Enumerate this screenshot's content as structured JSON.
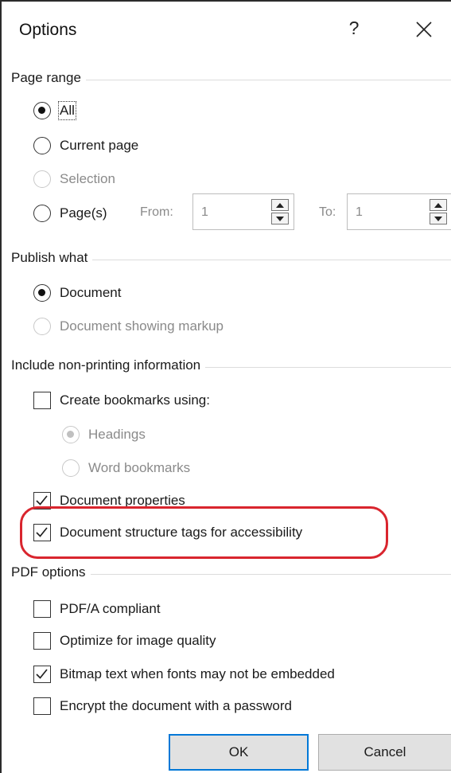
{
  "dialog": {
    "title": "Options",
    "help_label": "?"
  },
  "page_range": {
    "title": "Page range",
    "all": "All",
    "current_page": "Current page",
    "selection": "Selection",
    "pages": "Page(s)",
    "from_label": "From:",
    "from_value": "1",
    "to_label": "To:",
    "to_value": "1"
  },
  "publish_what": {
    "title": "Publish what",
    "document": "Document",
    "document_markup": "Document showing markup"
  },
  "non_printing": {
    "title": "Include non-printing information",
    "create_bookmarks": "Create bookmarks using:",
    "headings": "Headings",
    "word_bookmarks": "Word bookmarks",
    "doc_properties": "Document properties",
    "structure_tags": "Document structure tags for accessibility"
  },
  "pdf_options": {
    "title": "PDF options",
    "pdfa": "PDF/A compliant",
    "optimize": "Optimize for image quality",
    "bitmap": "Bitmap text when fonts may not be embedded",
    "encrypt": "Encrypt the document with a password"
  },
  "buttons": {
    "ok": "OK",
    "cancel": "Cancel"
  },
  "colors": {
    "highlight": "#d9252e",
    "default_button_border": "#0078d7"
  }
}
